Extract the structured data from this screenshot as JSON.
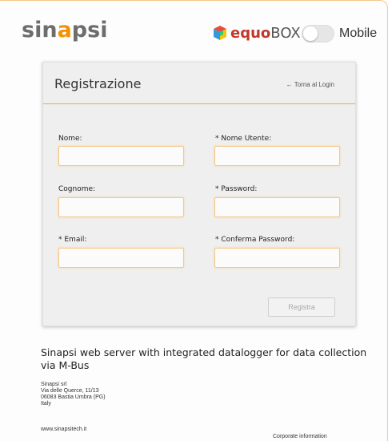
{
  "header": {
    "logo_text": "sinapsi",
    "equobox_logo": "equoBOX",
    "mobile_toggle": {
      "label": "Mobile",
      "on": false
    }
  },
  "form": {
    "title": "Registrazione",
    "back_link": "← Torna al Login",
    "fields": {
      "nome": {
        "label": "Nome:",
        "value": ""
      },
      "nome_utente": {
        "label": "* Nome Utente:",
        "value": ""
      },
      "cognome": {
        "label": "Cognome:",
        "value": ""
      },
      "password": {
        "label": "* Password:",
        "value": ""
      },
      "email": {
        "label": "* Email:",
        "value": ""
      },
      "conferma_password": {
        "label": "* Conferma Password:",
        "value": ""
      }
    },
    "submit_label": "Registra"
  },
  "footer": {
    "description": "Sinapsi web server with integrated datalogger for data collection via M-Bus",
    "company": [
      "Sinapsi srl",
      "Via delle Querce, 11/13",
      "06083 Bastia Umbra (PG)",
      "Italy"
    ],
    "website": "www.sinapsitech.it",
    "corporate_link": "Corporate information"
  },
  "colors": {
    "accent": "#f39200",
    "field_border": "#f5c689",
    "divider": "#f3a842",
    "card_bg": "#efefef"
  }
}
